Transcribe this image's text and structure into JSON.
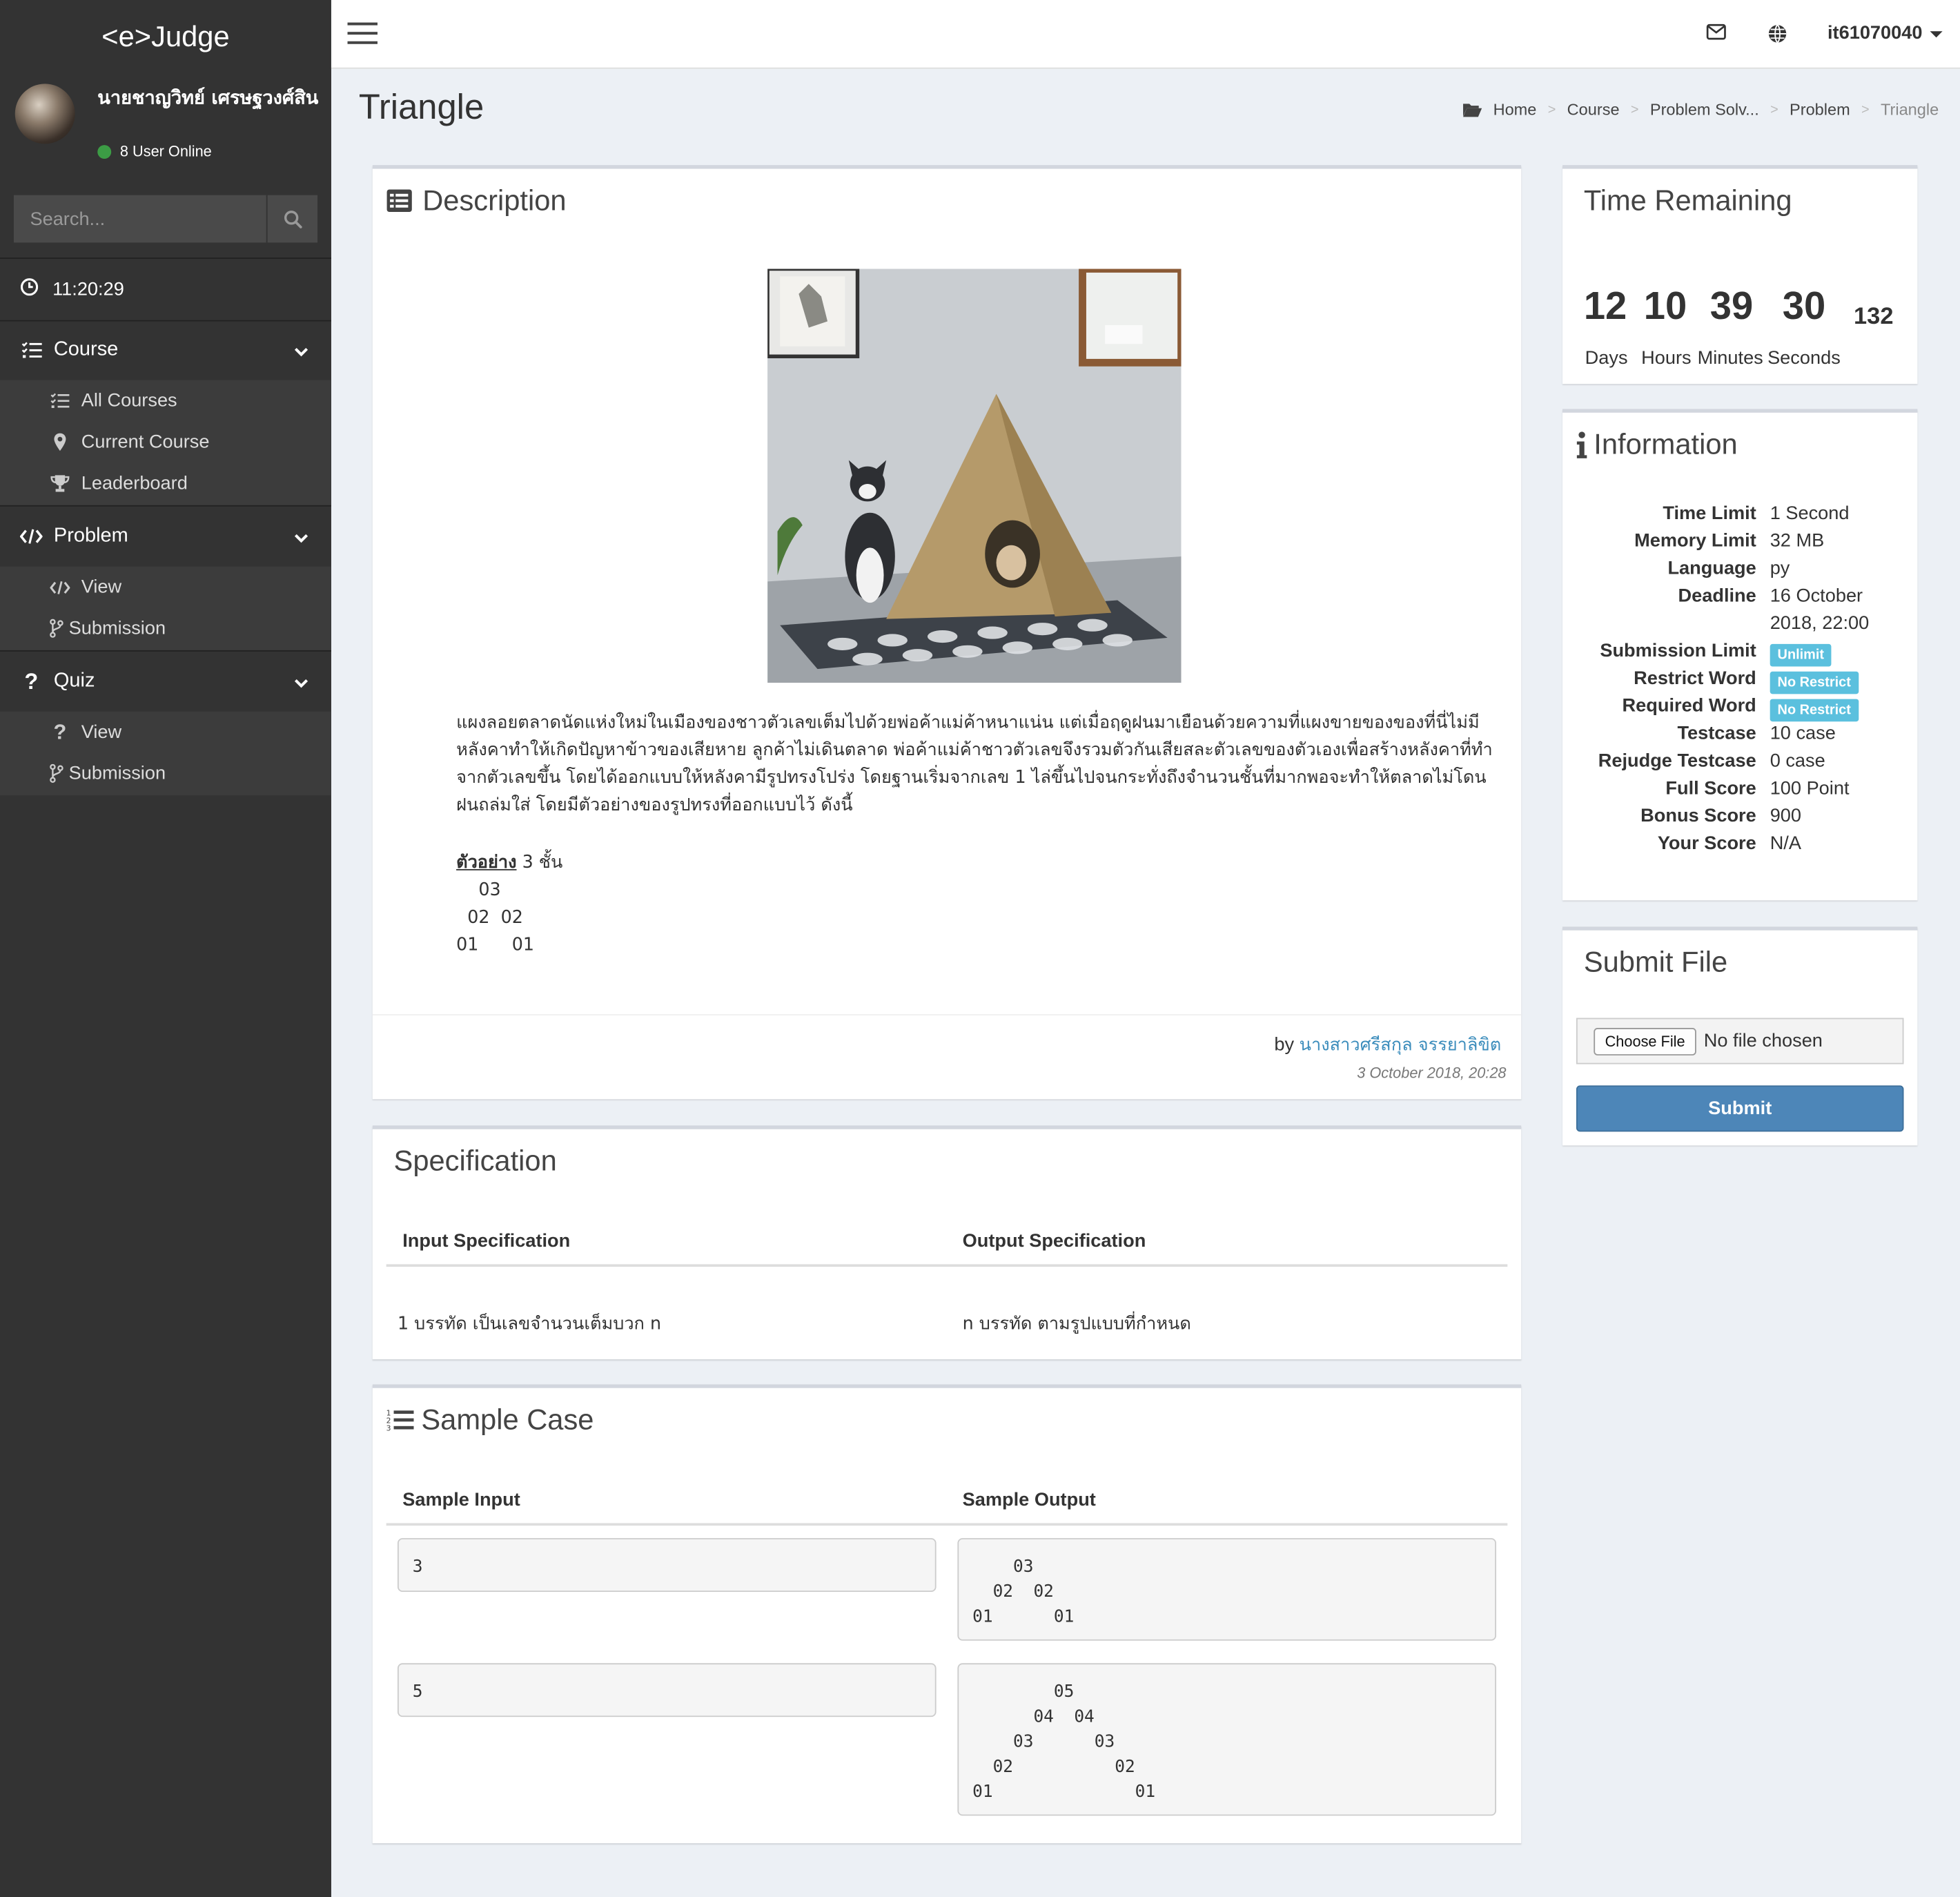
{
  "app": {
    "logo": "<e>Judge"
  },
  "user": {
    "name": "นายชาญวิทย์ เศรษฐวงศ์สิน",
    "online": "8 User Online"
  },
  "search": {
    "placeholder": "Search..."
  },
  "clock": "11:20:29",
  "sidebar": {
    "course": {
      "label": "Course",
      "items": [
        "All Courses",
        "Current Course",
        "Leaderboard"
      ]
    },
    "problem": {
      "label": "Problem",
      "items": [
        "View",
        "Submission"
      ]
    },
    "quiz": {
      "label": "Quiz",
      "items": [
        "View",
        "Submission"
      ]
    }
  },
  "topbar": {
    "username": "it61070040"
  },
  "page": {
    "title": "Triangle"
  },
  "breadcrumb": [
    "Home",
    "Course",
    "Problem Solv...",
    "Problem",
    "Triangle"
  ],
  "description": {
    "title": "Description",
    "text": "แผงลอยตลาดนัดแห่งใหม่ในเมืองของชาวตัวเลขเต็มไปด้วยพ่อค้าแม่ค้าหนาแน่น แต่เมื่อฤดูฝนมาเยือนด้วยความที่แผงขายของของที่นี่ไม่มีหลังคาทำให้เกิดปัญหาข้าวของเสียหาย ลูกค้าไม่เดินตลาด พ่อค้าแม่ค้าชาวตัวเลขจึงรวมตัวกันเสียสละตัวเลขของตัวเองเพื่อสร้างหลังคาที่ทำจากตัวเลขขึ้น โดยได้ออกแบบให้หลังคามีรูปทรงโปร่ง โดยฐานเริ่มจากเลข 1 ไล่ขึ้นไปจนกระทั่งถึงจำนวนชั้นที่มากพอจะทำให้ตลาดไม่โดนฝนถล่มใส่ โดยมีตัวอย่างของรูปทรงที่ออกแบบไว้ ดังนี้",
    "example_label": "ตัวอย่าง",
    "example_suffix": " 3 ชั้น",
    "example_lines": [
      "    03",
      "  02  02",
      "01      01"
    ],
    "by_label": "by",
    "author": "นางสาวศรีสกุล จรรยาลิขิต",
    "date": "3 October 2018, 20:28"
  },
  "specification": {
    "title": "Specification",
    "input_header": "Input Specification",
    "output_header": "Output Specification",
    "input": "1 บรรทัด เป็นเลขจำนวนเต็มบวก n",
    "output": "n บรรทัด ตามรูปแบบที่กำหนด"
  },
  "sample": {
    "title": "Sample Case",
    "input_header": "Sample Input",
    "output_header": "Sample Output",
    "cases": [
      {
        "input": "3",
        "output": "    03\n  02  02\n01      01"
      },
      {
        "input": "5",
        "output": "        05\n      04  04\n    03      03\n  02          02\n01              01"
      }
    ]
  },
  "time_remaining": {
    "title": "Time Remaining",
    "days": "12",
    "hours": "10",
    "minutes": "39",
    "seconds": "30",
    "ms": "132",
    "labels": {
      "days": "Days",
      "hours": "Hours",
      "minutes": "Minutes",
      "seconds": "Seconds"
    }
  },
  "information": {
    "title": "Information",
    "rows": [
      {
        "k": "Time Limit",
        "v": "1 Second"
      },
      {
        "k": "Memory Limit",
        "v": "32 MB"
      },
      {
        "k": "Language",
        "v": "py"
      },
      {
        "k": "Deadline",
        "v": "16 October",
        "v2": "2018, 22:00"
      },
      {
        "k": "Submission Limit",
        "badge": "Unlimit"
      },
      {
        "k": "Restrict Word",
        "badge": "No Restrict"
      },
      {
        "k": "Required Word",
        "badge": "No Restrict"
      },
      {
        "k": "Testcase",
        "v": "10 case"
      },
      {
        "k": "Rejudge Testcase",
        "v": "0 case"
      },
      {
        "k": "Full Score",
        "v": "100 Point"
      },
      {
        "k": "Bonus Score",
        "v": "900"
      },
      {
        "k": "Your Score",
        "v": "N/A"
      }
    ]
  },
  "submit": {
    "title": "Submit File",
    "choose": "Choose File",
    "no_file": "No file chosen",
    "button": "Submit"
  },
  "colors": {
    "sidebar": "#333333",
    "accent": "#3c8dbc",
    "badge": "#5bc0de",
    "submit": "#4d86b8",
    "online": "#3c9c45"
  }
}
